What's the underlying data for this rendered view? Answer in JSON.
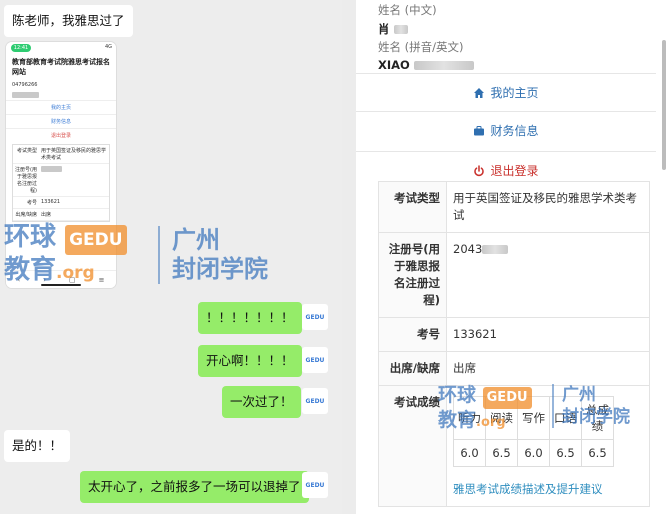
{
  "chat": {
    "messages": [
      {
        "side": "in",
        "text": "陈老师，我雅思过了"
      },
      {
        "side": "out",
        "text": "！！！！！！！"
      },
      {
        "side": "out",
        "text": "开心啊！！！！"
      },
      {
        "side": "out",
        "text": "一次过了！"
      },
      {
        "side": "in",
        "text": "是的！！"
      },
      {
        "side": "out",
        "text": "太开心了，之前报多了一场可以退掉了"
      }
    ],
    "avatar_text": "GEDU",
    "phone_screenshot": {
      "status_time": "12:41",
      "status_right": "4G",
      "title": "教育部教育考试院雅思考试报名网站",
      "number": "04796266",
      "links": [
        "我的主页",
        "财务信息",
        "退出登录"
      ],
      "rows": [
        {
          "key": "考试类型",
          "value": "用于英国签证及移民的雅思学术类考试"
        },
        {
          "key": "注册号(用于雅思报名注册过程)",
          "value": ""
        },
        {
          "key": "考号",
          "value": "133621"
        },
        {
          "key": "出席/缺席",
          "value": "出席"
        }
      ]
    }
  },
  "web": {
    "name_cn_label": "姓名 (中文)",
    "name_cn_value": "肖",
    "name_en_label": "姓名 (拼音/英文)",
    "name_en_value": "XIAO",
    "menu": {
      "home": "我的主页",
      "finance": "财务信息",
      "logout": "退出登录"
    },
    "table": {
      "exam_type_key": "考试类型",
      "exam_type_value": "用于英国签证及移民的雅思学术类考试",
      "reg_key": "注册号(用于雅思报名注册过程)",
      "reg_value": "2043",
      "candidate_key": "考号",
      "candidate_value": "133621",
      "attendance_key": "出席/缺席",
      "attendance_value": "出席",
      "scores_key": "考试成绩",
      "score_headers": [
        "听力",
        "阅读",
        "写作",
        "口语",
        "总成绩"
      ],
      "score_values": [
        "6.0",
        "6.5",
        "6.0",
        "6.5",
        "6.5"
      ],
      "link": "雅思考试成绩描述及提升建议"
    }
  },
  "watermark": {
    "line1": "环球",
    "line2": "教育",
    "brand": "GEDU",
    "org": ".org",
    "right1": "广州",
    "right2": "封闭学院"
  },
  "colors": {
    "out_bubble": "#95ec69",
    "link_blue": "#2f6fb0",
    "logout_red": "#c9302c",
    "watermark_blue": "#4078be",
    "watermark_orange": "#f08c28"
  }
}
